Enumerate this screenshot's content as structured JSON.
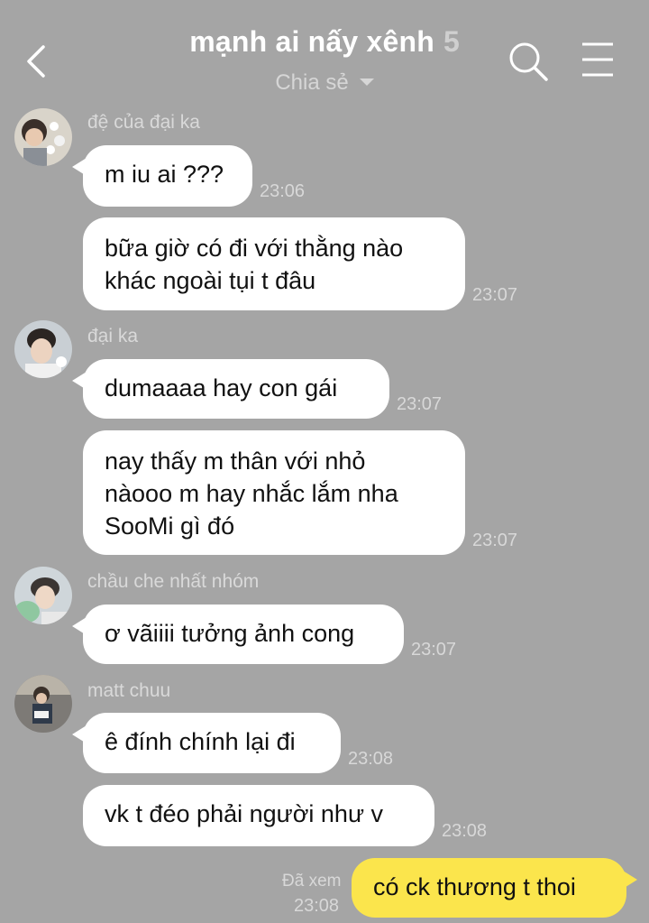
{
  "header": {
    "title": "mạnh ai nấy xênh",
    "member_count": "5",
    "subtitle": "Chia sẻ"
  },
  "messages": [
    {
      "sender": "đệ của đại ka",
      "text": "m iu ai ???",
      "time": "23:06"
    },
    {
      "sender": "",
      "text": "bữa giờ có đi với thằng nào\nkhác ngoài tụi t đâu",
      "time": "23:07"
    },
    {
      "sender": "đại ka",
      "text": "dumaaaa hay con gái",
      "time": "23:07"
    },
    {
      "sender": "",
      "text": "nay thấy m thân với nhỏ\nnàooo m hay nhắc lắm nha\nSooMi gì đó",
      "time": "23:07"
    },
    {
      "sender": "chầu che nhất nhóm",
      "text": "ơ vãiiii tưởng ảnh cong",
      "time": "23:07"
    },
    {
      "sender": "matt chuu",
      "text": "ê đính chính lại đi",
      "time": "23:08"
    },
    {
      "sender": "",
      "text": "vk t đéo phải người như v",
      "time": "23:08"
    }
  ],
  "my_message": {
    "text": "có ck thương t thoi",
    "seen_label": "Đã xem",
    "time": "23:08"
  },
  "colors": {
    "background": "#a5a5a5",
    "my_bubble": "#fbe54c",
    "other_bubble": "#ffffff"
  },
  "icons": [
    "back-arrow-icon",
    "search-icon",
    "menu-icon",
    "caret-down-icon"
  ]
}
